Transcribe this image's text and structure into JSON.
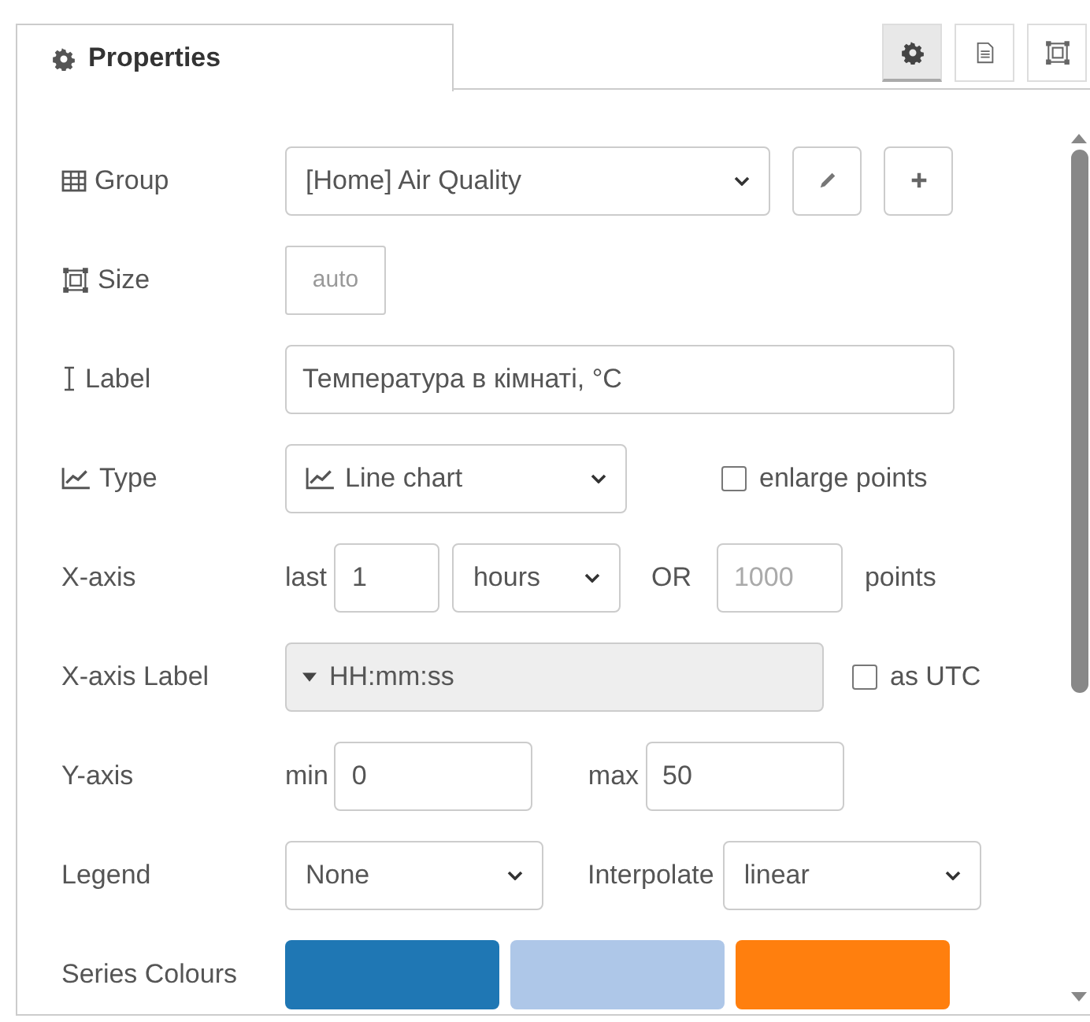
{
  "tab": {
    "label": "Properties",
    "selected": true
  },
  "toolbar": [
    {
      "kind": "gear",
      "selected": true
    },
    {
      "kind": "document",
      "selected": false
    },
    {
      "kind": "frame",
      "selected": false
    }
  ],
  "rows": [
    {
      "kind": "group",
      "label": "Group",
      "value": "[Home] Air Quality"
    },
    {
      "kind": "size",
      "label": "Size",
      "value": "auto"
    },
    {
      "kind": "text",
      "label": "Label",
      "value": "Температура в кімнаті, °C"
    },
    {
      "kind": "type",
      "label": "Type",
      "value": "Line chart",
      "checkbox": {
        "label": "enlarge points",
        "checked": false
      }
    },
    {
      "kind": "xaxis",
      "label": "X-axis",
      "prefix": "last",
      "value": "1",
      "unit": "hours",
      "joiner": "OR",
      "points_placeholder": "1000",
      "suffix": "points"
    },
    {
      "kind": "xlabel",
      "label": "X-axis Label",
      "value": "HH:mm:ss",
      "checkbox": {
        "label": "as UTC",
        "checked": false
      }
    },
    {
      "kind": "yaxis",
      "label": "Y-axis",
      "min_label": "min",
      "min": "0",
      "max_label": "max",
      "max": "50"
    },
    {
      "kind": "legend",
      "label": "Legend",
      "value": "None",
      "interp_label": "Interpolate",
      "interp": "linear"
    },
    {
      "kind": "colours",
      "label": "Series Colours",
      "colours": [
        {
          "color": "#1f77b4"
        },
        {
          "color": "#aec7e8"
        },
        {
          "color": "#ff7f0e"
        }
      ]
    }
  ]
}
